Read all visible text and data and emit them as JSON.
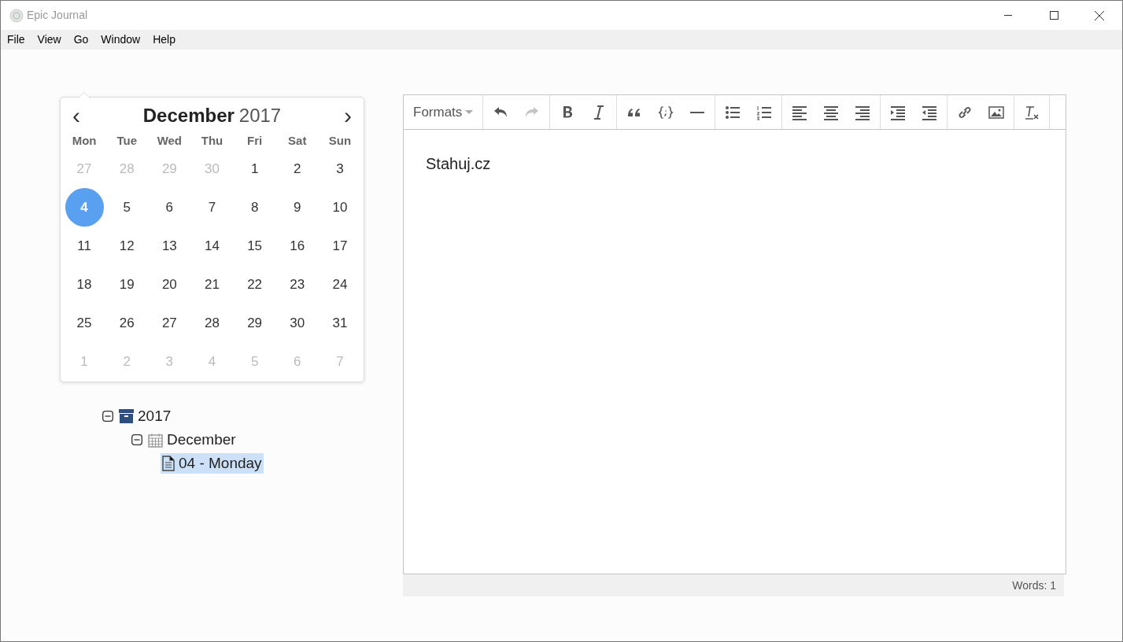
{
  "window": {
    "title": "Epic Journal"
  },
  "menu": [
    "File",
    "View",
    "Go",
    "Window",
    "Help"
  ],
  "calendar": {
    "month": "December",
    "year": "2017",
    "prev": "‹",
    "next": "›",
    "weekdays": [
      "Mon",
      "Tue",
      "Wed",
      "Thu",
      "Fri",
      "Sat",
      "Sun"
    ],
    "days": [
      {
        "label": "27",
        "muted": true,
        "selected": false
      },
      {
        "label": "28",
        "muted": true,
        "selected": false
      },
      {
        "label": "29",
        "muted": true,
        "selected": false
      },
      {
        "label": "30",
        "muted": true,
        "selected": false
      },
      {
        "label": "1",
        "muted": false,
        "selected": false
      },
      {
        "label": "2",
        "muted": false,
        "selected": false
      },
      {
        "label": "3",
        "muted": false,
        "selected": false
      },
      {
        "label": "4",
        "muted": false,
        "selected": true
      },
      {
        "label": "5",
        "muted": false,
        "selected": false
      },
      {
        "label": "6",
        "muted": false,
        "selected": false
      },
      {
        "label": "7",
        "muted": false,
        "selected": false
      },
      {
        "label": "8",
        "muted": false,
        "selected": false
      },
      {
        "label": "9",
        "muted": false,
        "selected": false
      },
      {
        "label": "10",
        "muted": false,
        "selected": false
      },
      {
        "label": "11",
        "muted": false,
        "selected": false
      },
      {
        "label": "12",
        "muted": false,
        "selected": false
      },
      {
        "label": "13",
        "muted": false,
        "selected": false
      },
      {
        "label": "14",
        "muted": false,
        "selected": false
      },
      {
        "label": "15",
        "muted": false,
        "selected": false
      },
      {
        "label": "16",
        "muted": false,
        "selected": false
      },
      {
        "label": "17",
        "muted": false,
        "selected": false
      },
      {
        "label": "18",
        "muted": false,
        "selected": false
      },
      {
        "label": "19",
        "muted": false,
        "selected": false
      },
      {
        "label": "20",
        "muted": false,
        "selected": false
      },
      {
        "label": "21",
        "muted": false,
        "selected": false
      },
      {
        "label": "22",
        "muted": false,
        "selected": false
      },
      {
        "label": "23",
        "muted": false,
        "selected": false
      },
      {
        "label": "24",
        "muted": false,
        "selected": false
      },
      {
        "label": "25",
        "muted": false,
        "selected": false
      },
      {
        "label": "26",
        "muted": false,
        "selected": false
      },
      {
        "label": "27",
        "muted": false,
        "selected": false
      },
      {
        "label": "28",
        "muted": false,
        "selected": false
      },
      {
        "label": "29",
        "muted": false,
        "selected": false
      },
      {
        "label": "30",
        "muted": false,
        "selected": false
      },
      {
        "label": "31",
        "muted": false,
        "selected": false
      },
      {
        "label": "1",
        "muted": true,
        "selected": false
      },
      {
        "label": "2",
        "muted": true,
        "selected": false
      },
      {
        "label": "3",
        "muted": true,
        "selected": false
      },
      {
        "label": "4",
        "muted": true,
        "selected": false
      },
      {
        "label": "5",
        "muted": true,
        "selected": false
      },
      {
        "label": "6",
        "muted": true,
        "selected": false
      },
      {
        "label": "7",
        "muted": true,
        "selected": false
      }
    ]
  },
  "tree": [
    {
      "label": "2017",
      "kind": "year",
      "expanded": true,
      "selected": false,
      "children": [
        {
          "label": "December",
          "kind": "month",
          "expanded": true,
          "selected": false,
          "children": [
            {
              "label": "04 - Monday",
              "kind": "entry",
              "selected": true
            }
          ]
        }
      ]
    }
  ],
  "toolbar": {
    "formats": "Formats",
    "groups": [
      [
        {
          "kind": "undo",
          "disabled": false
        },
        {
          "kind": "redo",
          "disabled": true
        }
      ],
      [
        {
          "kind": "bold",
          "disabled": false
        },
        {
          "kind": "italic",
          "disabled": false
        }
      ],
      [
        {
          "kind": "quote",
          "disabled": false
        },
        {
          "kind": "code",
          "disabled": false
        },
        {
          "kind": "rule",
          "disabled": false
        }
      ],
      [
        {
          "kind": "bullets",
          "disabled": false
        },
        {
          "kind": "numbers",
          "disabled": false
        }
      ],
      [
        {
          "kind": "align-left",
          "disabled": false
        },
        {
          "kind": "align-center",
          "disabled": false
        },
        {
          "kind": "align-right",
          "disabled": false
        }
      ],
      [
        {
          "kind": "indent",
          "disabled": false
        },
        {
          "kind": "outdent",
          "disabled": false
        }
      ],
      [
        {
          "kind": "link",
          "disabled": false
        },
        {
          "kind": "image",
          "disabled": false
        }
      ],
      [
        {
          "kind": "clear",
          "disabled": false
        }
      ]
    ]
  },
  "editor": {
    "content": "Stahuj.cz"
  },
  "status_bar": {
    "words": "Words: 1"
  }
}
